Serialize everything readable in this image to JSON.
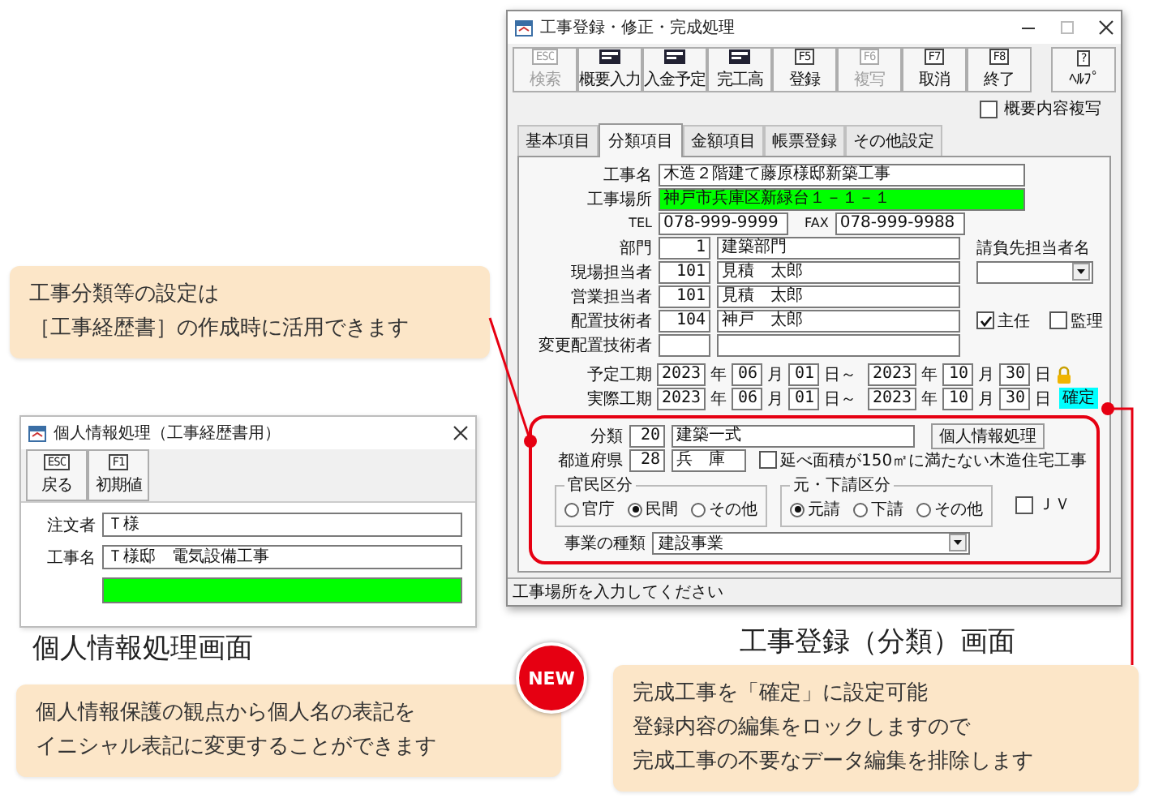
{
  "main_window": {
    "title": "工事登録・修正・完成処理",
    "toolbar": [
      {
        "kind": "key",
        "key": "ESC",
        "label": "検索",
        "disabled": true
      },
      {
        "kind": "icon",
        "label": "概要入力",
        "disabled": false
      },
      {
        "kind": "icon",
        "label": "入金予定",
        "disabled": false
      },
      {
        "kind": "icon",
        "label": "完工高",
        "disabled": false
      },
      {
        "kind": "key",
        "key": "F5",
        "label": "登録",
        "disabled": false
      },
      {
        "kind": "key",
        "key": "F6",
        "label": "複写",
        "disabled": true
      },
      {
        "kind": "key",
        "key": "F7",
        "label": "取消",
        "disabled": false
      },
      {
        "kind": "key",
        "key": "F8",
        "label": "終了",
        "disabled": false
      },
      {
        "kind": "key",
        "key": "?",
        "label": "ﾍﾙﾌﾟ",
        "disabled": false
      }
    ],
    "copy_option": {
      "label": "概要内容複写",
      "checked": false
    },
    "tabs": [
      {
        "label": "基本項目",
        "selected": false
      },
      {
        "label": "分類項目",
        "selected": true
      },
      {
        "label": "金額項目",
        "selected": false
      },
      {
        "label": "帳票登録",
        "selected": false
      },
      {
        "label": "その他設定",
        "selected": false
      }
    ],
    "project_name": {
      "label": "工事名",
      "value": "木造２階建て藤原様邸新築工事",
      "focused": false
    },
    "site": {
      "label": "工事場所",
      "value": "神戸市兵庫区新緑台１－１－１",
      "focused": true
    },
    "phone": {
      "tel_label": "TEL",
      "tel": "078-999-9999",
      "fax_label": "FAX",
      "fax": "078-999-9988"
    },
    "department": {
      "label": "部門",
      "code": "1",
      "name": "建築部門"
    },
    "client_contact": {
      "label": "請負先担当者名"
    },
    "staff": [
      {
        "label": "現場担当者",
        "code": "101",
        "name": "見積　太郎"
      },
      {
        "label": "営業担当者",
        "code": "101",
        "name": "見積　太郎"
      },
      {
        "label": "配置技術者",
        "code": "104",
        "name": "神戸　太郎"
      },
      {
        "label": "変更配置技術者"
      }
    ],
    "engineer_roles": [
      {
        "label": "主任",
        "checked": true
      },
      {
        "label": "監理",
        "checked": false
      }
    ],
    "periods": [
      {
        "label": "予定工期",
        "kind": "locked",
        "start": {
          "year": "2023",
          "year_unit": "年",
          "month": "06",
          "month_unit": "月",
          "day": "01",
          "day_unit": "日～"
        },
        "end": {
          "year": "2023",
          "year_unit": "年",
          "month": "10",
          "month_unit": "月",
          "day": "30",
          "day_unit": "日"
        }
      },
      {
        "label": "実際工期",
        "kind": "confirmed",
        "badge": "確定",
        "start": {
          "year": "2023",
          "year_unit": "年",
          "month": "06",
          "month_unit": "月",
          "day": "01",
          "day_unit": "日～"
        },
        "end": {
          "year": "2023",
          "year_unit": "年",
          "month": "10",
          "month_unit": "月",
          "day": "30",
          "day_unit": "日"
        }
      }
    ],
    "classification": {
      "label": "分類",
      "code": "20",
      "name": "建築一式",
      "button": "個人情報処理"
    },
    "prefecture": {
      "label": "都道府県",
      "code": "28",
      "name": "兵　庫"
    },
    "small_house": {
      "label": "延べ面積が150㎡に満たない木造住宅工事",
      "checked": false
    },
    "radio_groups": [
      {
        "title": "官民区分",
        "options": [
          {
            "label": "官庁",
            "selected": false
          },
          {
            "label": "民間",
            "selected": true
          },
          {
            "label": "その他",
            "selected": false
          }
        ]
      },
      {
        "title": "元・下請区分",
        "options": [
          {
            "label": "元請",
            "selected": true
          },
          {
            "label": "下請",
            "selected": false
          },
          {
            "label": "その他",
            "selected": false
          }
        ]
      }
    ],
    "jv": {
      "label": "ＪＶ",
      "checked": false
    },
    "business_type": {
      "label": "事業の種類",
      "value": "建設事業"
    },
    "status_bar": "工事場所を入力してください"
  },
  "personal_window": {
    "title": "個人情報処理（工事経歴書用）",
    "toolbar": [
      {
        "key": "ESC",
        "label": "戻る"
      },
      {
        "key": "F1",
        "label": "初期値"
      }
    ],
    "fields": [
      {
        "label": "注文者",
        "value": "Ｔ様",
        "focused": false
      },
      {
        "label": "工事名",
        "value": "Ｔ様邸　電気設備工事",
        "focused": false
      },
      {
        "focused": true
      }
    ]
  },
  "callouts": [
    {
      "kind": "classification",
      "lines": [
        "工事分類等の設定は",
        "［工事経歴書］の作成時に活用できます"
      ]
    },
    {
      "kind": "privacy",
      "lines": [
        "個人情報保護の観点から個人名の表記を",
        "イニシャル表記に変更することができます"
      ]
    },
    {
      "kind": "lock",
      "lines": [
        "完成工事を「確定」に設定可能",
        "登録内容の編集をロックしますので",
        "完成工事の不要なデータ編集を排除します"
      ]
    }
  ],
  "captions": [
    {
      "kind": "personal",
      "text": "個人情報処理画面"
    },
    {
      "kind": "main",
      "text": "工事登録（分類）画面"
    }
  ],
  "new_badge": "NEW"
}
